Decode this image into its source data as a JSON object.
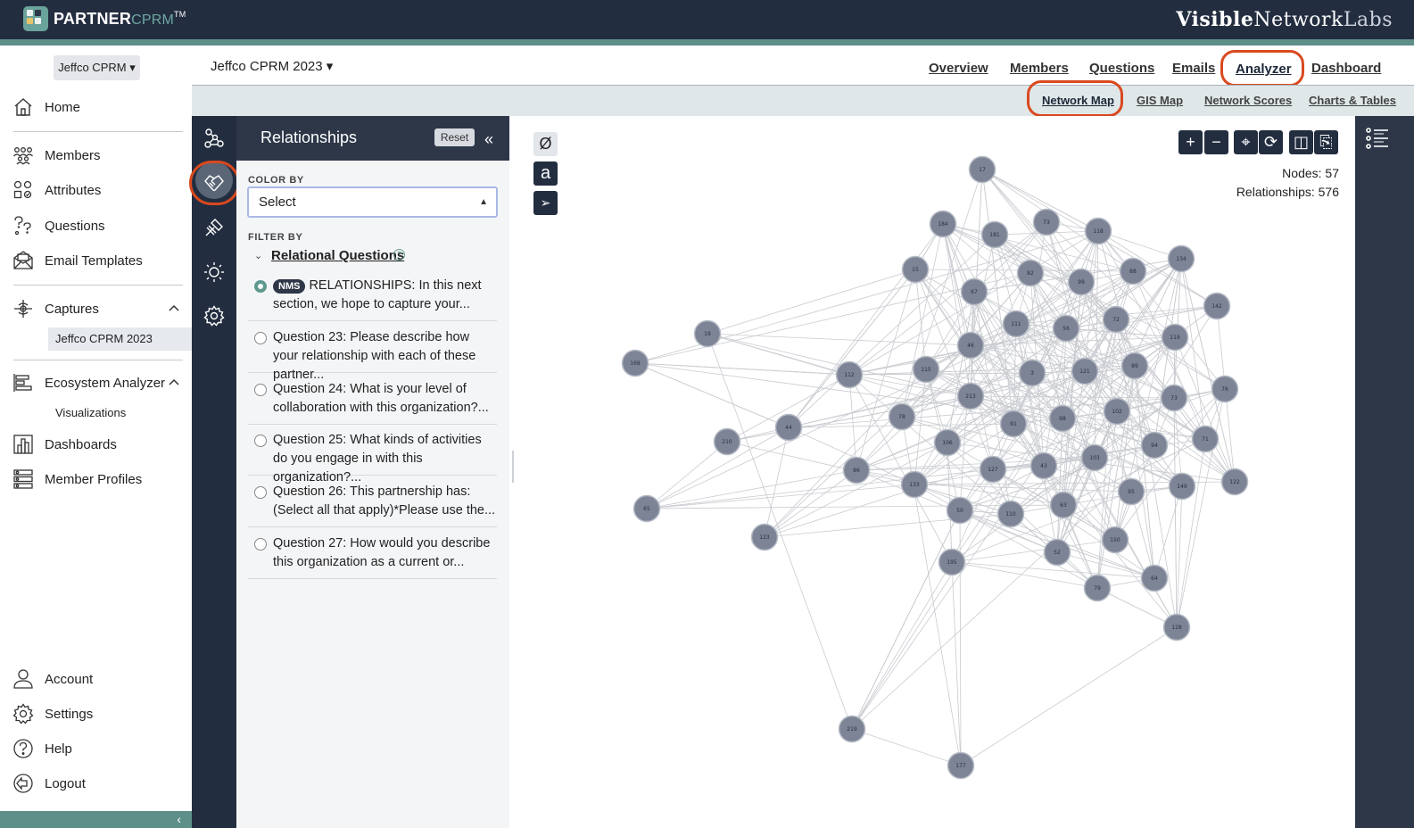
{
  "brand": {
    "name": "PARTNER",
    "suffix": "CPRM",
    "tm": "TM",
    "company_bold": "Visible",
    "company_mid": "Network",
    "company_light": "Labs"
  },
  "leftnav": {
    "org": "Jeffco CPRM ▾",
    "items": [
      {
        "label": "Home",
        "icon": "home-icon"
      },
      {
        "label": "Members",
        "icon": "members-icon"
      },
      {
        "label": "Attributes",
        "icon": "attributes-icon"
      },
      {
        "label": "Questions",
        "icon": "questions-icon"
      },
      {
        "label": "Email Templates",
        "icon": "email-icon"
      },
      {
        "label": "Captures",
        "icon": "captures-icon"
      },
      {
        "label": "Ecosystem Analyzer",
        "icon": "analyzer-icon"
      },
      {
        "label": "Dashboards",
        "icon": "dashboards-icon"
      },
      {
        "label": "Member Profiles",
        "icon": "profiles-icon"
      },
      {
        "label": "Account",
        "icon": "account-icon"
      },
      {
        "label": "Settings",
        "icon": "settings-icon"
      },
      {
        "label": "Help",
        "icon": "help-icon"
      },
      {
        "label": "Logout",
        "icon": "logout-icon"
      }
    ],
    "captures_sub": "Jeffco CPRM 2023",
    "analyzer_sub": "Visualizations"
  },
  "project": {
    "title": "Jeffco CPRM 2023 ▾"
  },
  "main_tabs": [
    "Overview",
    "Members",
    "Questions",
    "Emails",
    "Analyzer",
    "Dashboard"
  ],
  "sub_tabs": [
    "Network Map",
    "GIS Map",
    "Network Scores",
    "Charts & Tables"
  ],
  "panel": {
    "title": "Relationships",
    "reset": "Reset",
    "color_by_label": "COLOR BY",
    "color_by_value": "Select",
    "filter_by_label": "FILTER BY",
    "rq_title": "Relational Questions",
    "questions": [
      {
        "badge": "NMS",
        "text": "RELATIONSHIPS: In this next section, we hope to capture your...",
        "selected": true
      },
      {
        "text": "Question 23: Please describe how your relationship with each of these partner...",
        "selected": false
      },
      {
        "text": "Question 24: What is your level of collaboration with this organization?...",
        "selected": false
      },
      {
        "text": "Question 25: What kinds of activities do you engage in with this organization?...",
        "selected": false
      },
      {
        "text": "Question 26: This partnership has: (Select all that apply)*Please use the...",
        "selected": false
      },
      {
        "text": "Question 27: How would you describe this organization as a current or...",
        "selected": false
      }
    ]
  },
  "map": {
    "nodes_label": "Nodes: 57",
    "relationships_label": "Relationships: 576",
    "tools_right": [
      "+",
      "−",
      "⌖",
      "⟳",
      "◫",
      "⎘"
    ],
    "nodes": [
      {
        "id": "17"
      },
      {
        "id": "184"
      },
      {
        "id": "181"
      },
      {
        "id": "73"
      },
      {
        "id": "118"
      },
      {
        "id": "134"
      },
      {
        "id": "15"
      },
      {
        "id": "67"
      },
      {
        "id": "82"
      },
      {
        "id": "99"
      },
      {
        "id": "88"
      },
      {
        "id": "142"
      },
      {
        "id": "19"
      },
      {
        "id": "169"
      },
      {
        "id": "111"
      },
      {
        "id": "56"
      },
      {
        "id": "72"
      },
      {
        "id": "119"
      },
      {
        "id": "46"
      },
      {
        "id": "112"
      },
      {
        "id": "115"
      },
      {
        "id": "3"
      },
      {
        "id": "121"
      },
      {
        "id": "89"
      },
      {
        "id": "76"
      },
      {
        "id": "213"
      },
      {
        "id": "73"
      },
      {
        "id": "78"
      },
      {
        "id": "91"
      },
      {
        "id": "98"
      },
      {
        "id": "102"
      },
      {
        "id": "44"
      },
      {
        "id": "210"
      },
      {
        "id": "106"
      },
      {
        "id": "94"
      },
      {
        "id": "71"
      },
      {
        "id": "127"
      },
      {
        "id": "43"
      },
      {
        "id": "103"
      },
      {
        "id": "86"
      },
      {
        "id": "133"
      },
      {
        "id": "149"
      },
      {
        "id": "122"
      },
      {
        "id": "65"
      },
      {
        "id": "95"
      },
      {
        "id": "50"
      },
      {
        "id": "110"
      },
      {
        "id": "63"
      },
      {
        "id": "123"
      },
      {
        "id": "150"
      },
      {
        "id": "52"
      },
      {
        "id": "195"
      },
      {
        "id": "64"
      },
      {
        "id": "79"
      },
      {
        "id": "128"
      },
      {
        "id": "219"
      },
      {
        "id": "177"
      }
    ]
  }
}
